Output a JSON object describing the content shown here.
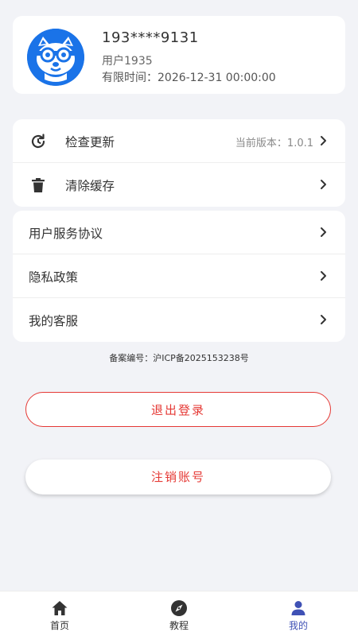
{
  "profile": {
    "phone": "193****9131",
    "username": "用户1935",
    "expiry_label": "有限时间：",
    "expiry_value": "2026-12-31 00:00:00"
  },
  "settings": {
    "items": [
      {
        "label": "检查更新",
        "value": "当前版本：1.0.1",
        "icon": "refresh-icon"
      },
      {
        "label": "清除缓存",
        "icon": "trash-icon"
      }
    ]
  },
  "legal": {
    "items": [
      {
        "label": "用户服务协议"
      },
      {
        "label": "隐私政策"
      },
      {
        "label": "我的客服"
      }
    ]
  },
  "icp": "备案编号：沪ICP备2025153238号",
  "buttons": {
    "logout": "退出登录",
    "cancel_account": "注销账号"
  },
  "tabbar": {
    "items": [
      {
        "label": "首页",
        "icon": "home-icon"
      },
      {
        "label": "教程",
        "icon": "compass-icon"
      },
      {
        "label": "我的",
        "icon": "person-icon",
        "active": true
      }
    ]
  },
  "colors": {
    "accent": "#3f51b5",
    "danger": "#e53935",
    "avatar_bg": "#1a73e8",
    "background": "#f2f3f7"
  }
}
